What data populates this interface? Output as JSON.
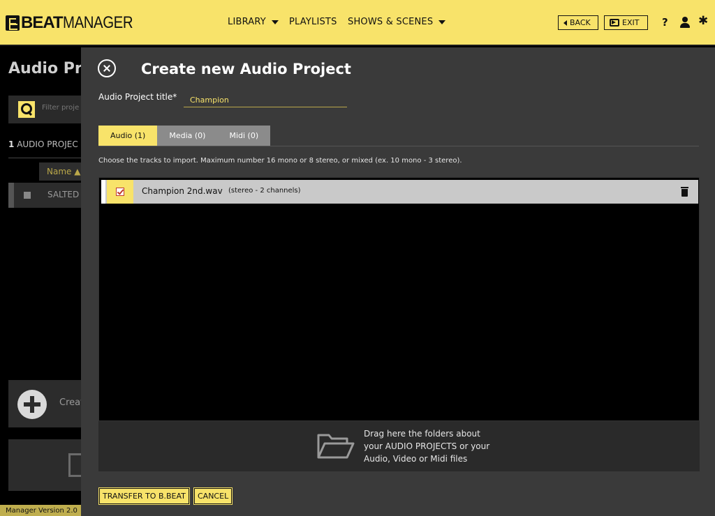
{
  "app": {
    "logo_bold": "BEAT",
    "logo_light": "MANAGER"
  },
  "nav": {
    "library": "LIBRARY",
    "playlists": "PLAYLISTS",
    "shows": "SHOWS & SCENES"
  },
  "toolbar": {
    "back": "BACK",
    "exit": "EXIT",
    "help": "?"
  },
  "background": {
    "title": "Audio Proj",
    "filter_placeholder": "Filter proje",
    "count_num": "1",
    "count_label": "AUDIO PROJEC",
    "col_name": "Name",
    "row_name": "SALTED V",
    "create_label": "Creat",
    "version": "Manager Version 2.0"
  },
  "modal": {
    "title": "Create new Audio Project",
    "title_label": "Audio Project title*",
    "title_value": "Champion",
    "tabs": [
      {
        "label": "Audio (1)",
        "active": true
      },
      {
        "label": "Media (0)",
        "active": false
      },
      {
        "label": "Midi (0)",
        "active": false
      }
    ],
    "hint": "Choose the tracks to import. Maximum number 16 mono or 8 stereo, or mixed (ex. 10 mono - 3 stereo).",
    "tracks": [
      {
        "name": "Champion 2nd.wav",
        "info": "(stereo - 2 channels)",
        "checked": true
      }
    ],
    "dropzone": {
      "line1": "Drag here the folders about",
      "line2": "your AUDIO PROJECTS or your",
      "line3": "Audio, Video or Midi files"
    },
    "transfer_button": "TRANSFER TO B.BEAT",
    "cancel_button": "CANCEL"
  },
  "colors": {
    "accent": "#f8e36a",
    "modal_bg": "#3a3a3a",
    "check_red": "#c0392b"
  }
}
